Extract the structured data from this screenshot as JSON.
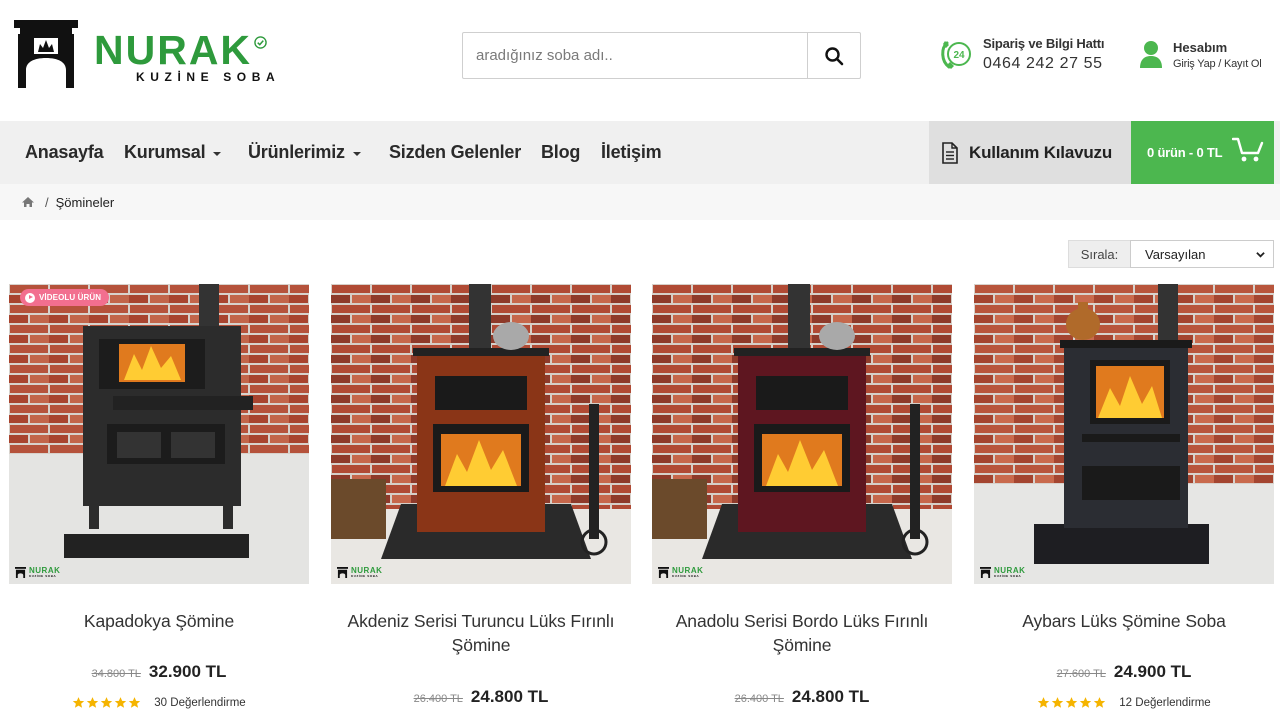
{
  "brand": {
    "name": "NURAK",
    "tagline": "KUZİNE SOBA"
  },
  "search": {
    "placeholder": "aradığınız soba adı.."
  },
  "hotline": {
    "badge": "24",
    "title": "Sipariş ve Bilgi Hattı",
    "number": "0464 242 27 55"
  },
  "account": {
    "title": "Hesabım",
    "subtitle": "Giriş Yap / Kayıt Ol"
  },
  "nav": {
    "items": [
      {
        "label": "Anasayfa"
      },
      {
        "label": "Kurumsal"
      },
      {
        "label": "Ürünlerimiz"
      },
      {
        "label": "Sizden Gelenler"
      },
      {
        "label": "Blog"
      },
      {
        "label": "İletişim"
      }
    ],
    "guide_label": "Kullanım Kılavuzu",
    "cart_label": "0 ürün - 0 TL"
  },
  "breadcrumb": {
    "separator": "/",
    "current": "Şömineler"
  },
  "sort": {
    "label": "Sırala:",
    "selected": "Varsayılan"
  },
  "products": [
    {
      "title": "Kapadokya Şömine",
      "old_price": "34.800 TL",
      "price": "32.900 TL",
      "rating": 5,
      "reviews": "30 Değerlendirme",
      "badge": "VİDEOLU ÜRÜN"
    },
    {
      "title": "Akdeniz Serisi Turuncu Lüks Fırınlı Şömine",
      "old_price": "26.400 TL",
      "price": "24.800 TL"
    },
    {
      "title": "Anadolu Serisi Bordo Lüks Fırınlı Şömine",
      "old_price": "26.400 TL",
      "price": "24.800 TL"
    },
    {
      "title": "Aybars Lüks Şömine Soba",
      "old_price": "27.600 TL",
      "price": "24.900 TL",
      "rating": 5,
      "reviews": "12 Değerlendirme"
    }
  ],
  "watermark": {
    "word": "NURAK",
    "sub": "KUZİNE SOBA"
  },
  "colors": {
    "brand_green": "#2e9a3c",
    "cart_green": "#4cb74f",
    "badge_pink": "#f26f8f",
    "star_yellow": "#f5b400"
  }
}
